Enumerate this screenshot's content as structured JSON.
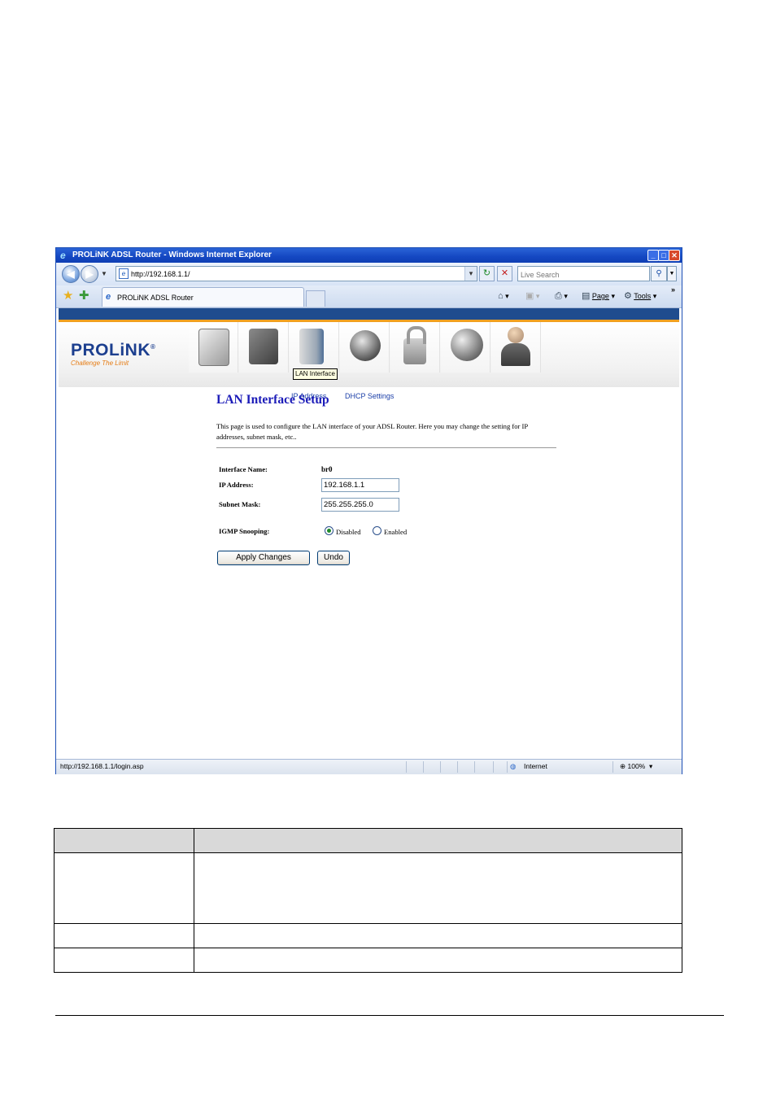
{
  "browser": {
    "window_title": "PROLiNK ADSL Router - Windows Internet Explorer",
    "address": "http://192.168.1.1/",
    "search_placeholder": "Live Search",
    "tab_label": "PROLiNK ADSL Router",
    "commands": {
      "page": "Page",
      "tools": "Tools"
    },
    "status_url": "http://192.168.1.1/login.asp",
    "status_zone": "Internet",
    "zoom": "100%"
  },
  "router": {
    "logo": {
      "brand": "PROLiNK",
      "registered": "®",
      "tagline": "Challenge The Limit"
    },
    "nav_icons": [
      "status-icon",
      "setup-icon",
      "lan-interface-icon",
      "wan-icon",
      "security-icon",
      "internet-icon",
      "admin-icon"
    ],
    "tooltip": "LAN Interface",
    "subnav": [
      "IP Address",
      "DHCP Settings"
    ],
    "colors": {
      "header_band": "#1f4c8e",
      "accent_stripe": "#f0a020",
      "title": "#1b1bb8"
    },
    "page_title": "LAN Interface Setup",
    "description": "This page is used to configure the LAN interface of your ADSL Router. Here you may change the setting for IP addresses, subnet mask, etc..",
    "fields": {
      "interface_name_label": "Interface Name:",
      "interface_name_value": "br0",
      "ip_label": "IP Address:",
      "ip_value": "192.168.1.1",
      "mask_label": "Subnet Mask:",
      "mask_value": "255.255.255.0",
      "igmp_label": "IGMP Snooping:",
      "igmp_options": [
        "Disabled",
        "Enabled"
      ],
      "igmp_selected": "Disabled"
    },
    "buttons": {
      "apply": "Apply Changes",
      "undo": "Undo"
    }
  }
}
